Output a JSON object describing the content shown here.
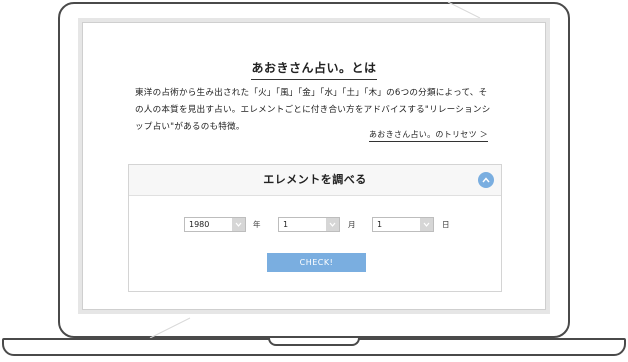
{
  "page": {
    "title": "あおきさん占い。とは",
    "description": "東洋の占術から生み出された「火」「風」「金」「水」「土」「木」の6つの分類によって、その人の本質を見出す占い。エレメントごとに付き合い方をアドバイスする\"リレーションシップ占い\"があるのも特徴。",
    "manual_link": "あおきさん占い。のトリセツ ＞"
  },
  "element_panel": {
    "title": "エレメントを調べる",
    "toggle_icon": "chevron-up-icon",
    "year": {
      "value": "1980",
      "unit": "年"
    },
    "month": {
      "value": "1",
      "unit": "月"
    },
    "day": {
      "value": "1",
      "unit": "日"
    },
    "check_button": "CHECK!"
  },
  "colors": {
    "accent": "#7aaee0",
    "frame": "#4a4a4a",
    "panel_header": "#f7f7f7"
  }
}
